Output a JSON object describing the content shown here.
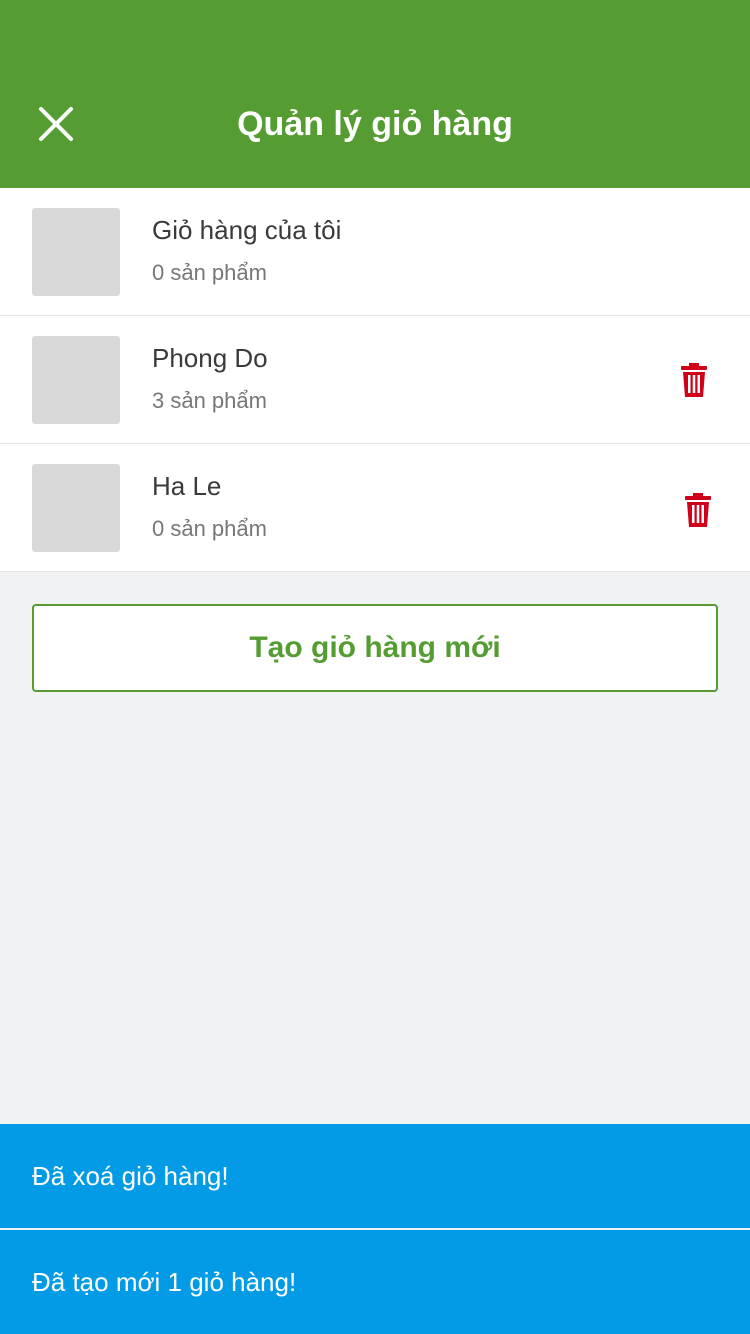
{
  "header": {
    "title": "Quản lý giỏ hàng",
    "close_icon": "close-icon",
    "background_color": "#559c32"
  },
  "carts": [
    {
      "name": "Giỏ hàng của tôi",
      "count": "0 sản phẩm",
      "deletable": false
    },
    {
      "name": "Phong Do",
      "count": "3 sản phẩm",
      "deletable": true,
      "delete_icon": "trash-icon"
    },
    {
      "name": "Ha Le",
      "count": "0 sản phẩm",
      "deletable": true,
      "delete_icon": "trash-icon"
    }
  ],
  "create_button": {
    "label": "Tạo giỏ hàng mới"
  },
  "toasts": [
    {
      "message": "Đã xoá giỏ hàng!"
    },
    {
      "message": "Đã tạo mới 1 giỏ hàng!"
    }
  ],
  "colors": {
    "primary": "#559c32",
    "danger": "#d0021b",
    "toast": "#039be5",
    "background": "#f1f2f4"
  }
}
